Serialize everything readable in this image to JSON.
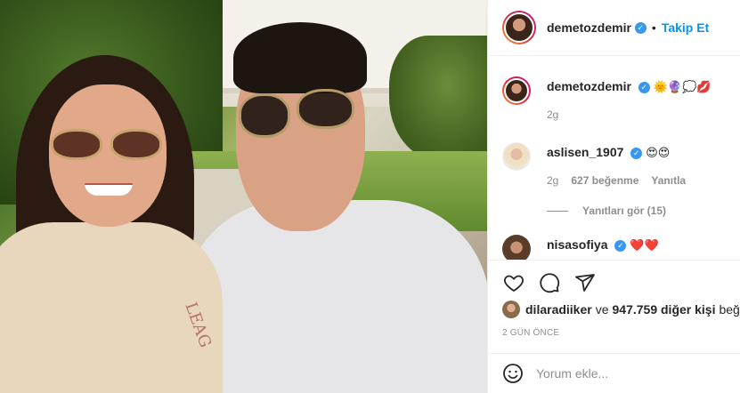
{
  "post": {
    "author": "demetozdemir",
    "follow_separator": "•",
    "follow_label": "Takip Et"
  },
  "caption": {
    "username": "demetozdemir",
    "emojis": "🌞🔮💭💋",
    "time": "2g"
  },
  "comments": [
    {
      "username": "aslisen_1907",
      "text": "😍😍",
      "time": "2g",
      "likes": "627 beğenme",
      "reply": "Yanıtla",
      "view_replies": "Yanıtları gör (15)"
    },
    {
      "username": "nisasofiya",
      "text": "❤️❤️"
    }
  ],
  "likes": {
    "user": "dilaradiiker",
    "connector": "ve",
    "others": "947.759 diğer kişi",
    "suffix": "beğe"
  },
  "timestamp": "2 GÜN ÖNCE",
  "comment_input": {
    "placeholder": "Yorum ekle..."
  },
  "icons": {
    "like": "heart-icon",
    "comment": "comment-icon",
    "share": "paper-plane-icon",
    "emoji": "smiley-icon",
    "verified": "verified-badge-icon"
  },
  "colors": {
    "link": "#0095f6",
    "verified": "#3897f0",
    "secondary_text": "#8e8e8e",
    "heart": "#ed4956"
  }
}
